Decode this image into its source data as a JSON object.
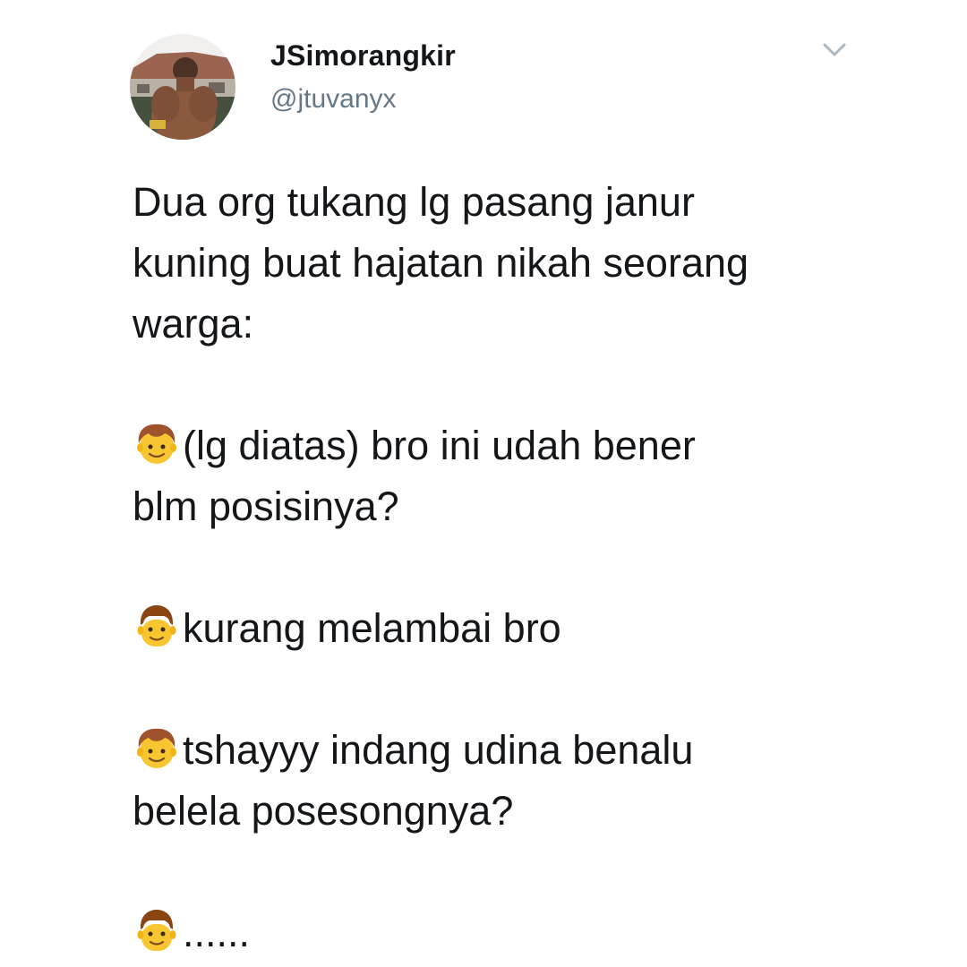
{
  "tweet": {
    "display_name": "JSimorangkir",
    "handle": "@jtuvanyx",
    "menu_icon": "chevron-down-icon",
    "avatar_icon": "avatar",
    "paragraphs": [
      {
        "lines": [
          {
            "text": "Dua org tukang lg pasang janur"
          },
          {
            "text": "kuning buat hajatan nikah seorang"
          },
          {
            "text": "warga:"
          }
        ]
      },
      {
        "lines": [
          {
            "emoji": "boy-emoji",
            "text": "(lg diatas) bro ini udah bener"
          },
          {
            "text": "blm posisinya?"
          }
        ]
      },
      {
        "lines": [
          {
            "emoji": "man-emoji",
            "text": "kurang melambai bro"
          }
        ]
      },
      {
        "lines": [
          {
            "emoji": "boy-emoji",
            "text": "tshayyy indang udina benalu"
          },
          {
            "text": "belela posesongnya?"
          }
        ]
      },
      {
        "lines": [
          {
            "emoji": "man-emoji",
            "text": "......"
          }
        ]
      }
    ]
  }
}
